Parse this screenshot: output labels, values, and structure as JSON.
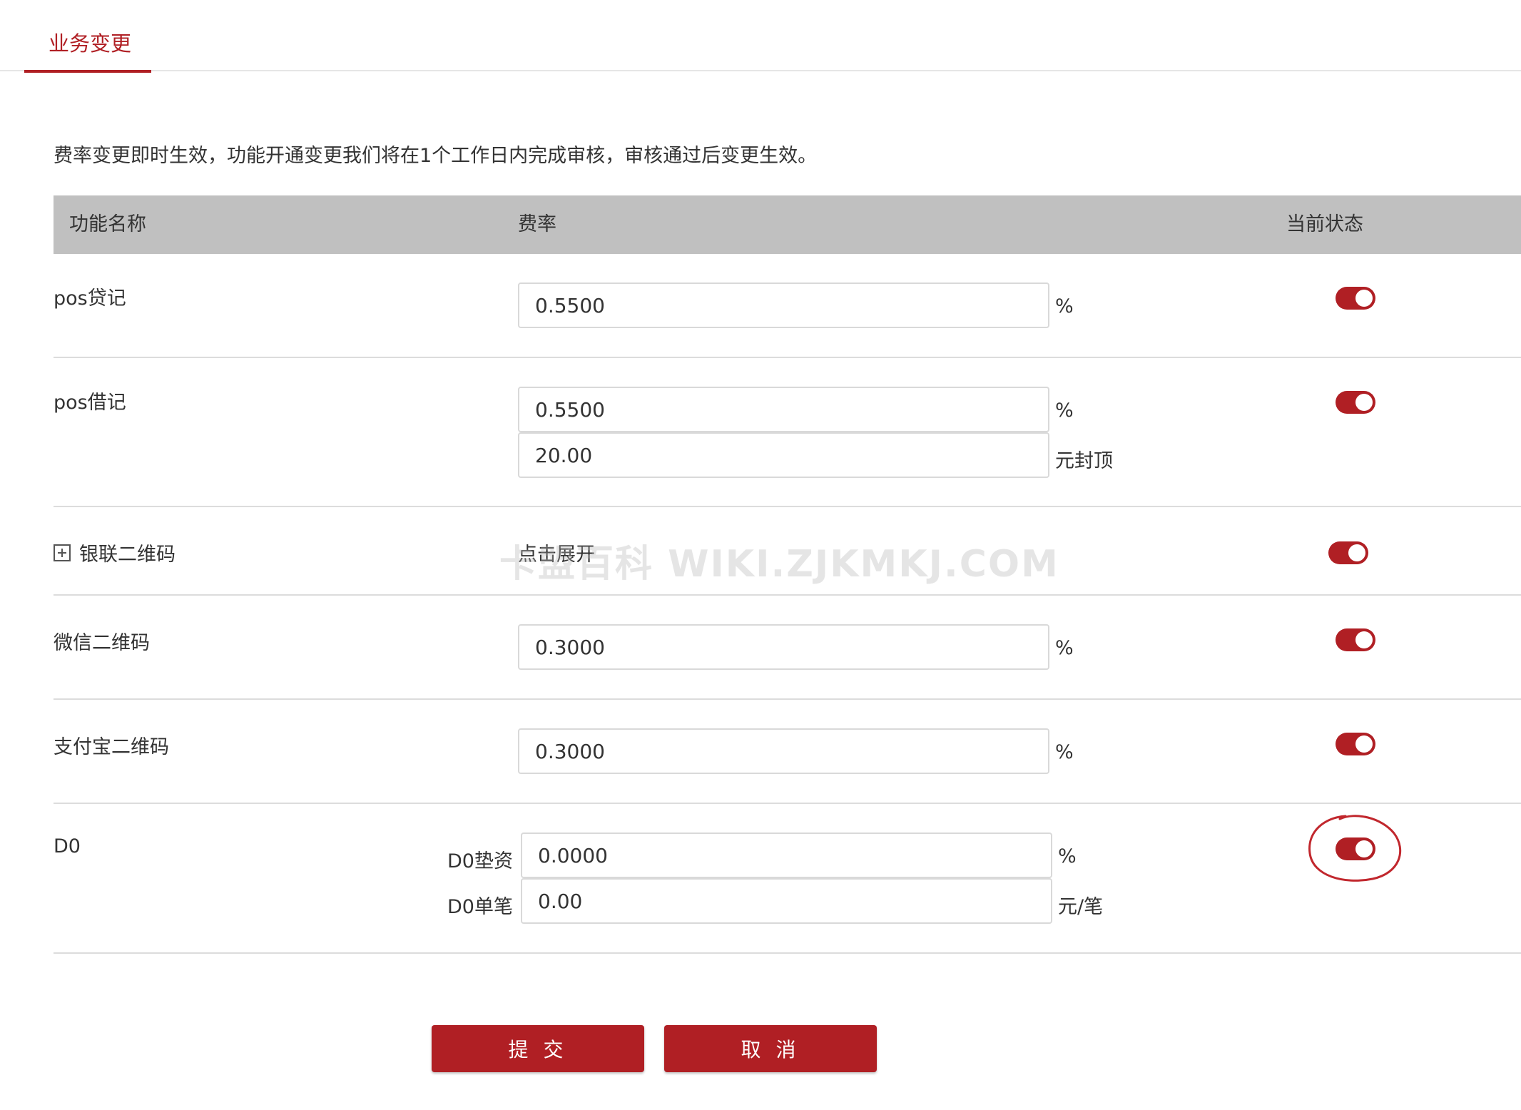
{
  "tabs": [
    {
      "label": "业务变更"
    }
  ],
  "notice": "费率变更即时生效，功能开通变更我们将在1个工作日内完成审核，审核通过后变更生效。",
  "table": {
    "headers": {
      "name": "功能名称",
      "rate": "费率",
      "status": "当前状态"
    }
  },
  "rows": {
    "pos_credit": {
      "name": "pos贷记",
      "rate_value": "0.5500",
      "rate_unit": "%",
      "enabled": true
    },
    "pos_debit": {
      "name": "pos借记",
      "rate_value": "0.5500",
      "rate_unit": "%",
      "cap_value": "20.00",
      "cap_unit": "元封顶",
      "enabled": true
    },
    "unionpay_qr": {
      "name": "银联二维码",
      "expand_label": "点击展开",
      "enabled": true
    },
    "wechat_qr": {
      "name": "微信二维码",
      "rate_value": "0.3000",
      "rate_unit": "%",
      "enabled": true
    },
    "alipay_qr": {
      "name": "支付宝二维码",
      "rate_value": "0.3000",
      "rate_unit": "%",
      "enabled": true
    },
    "d0": {
      "name": "D0",
      "advance_label": "D0垫资",
      "advance_value": "0.0000",
      "advance_unit": "%",
      "per_txn_label": "D0单笔",
      "per_txn_value": "0.00",
      "per_txn_unit": "元/笔",
      "enabled": true
    }
  },
  "watermark": "卡盟百科  WIKI.ZJKMKJ.COM",
  "buttons": {
    "submit": "提 交",
    "cancel": "取 消"
  },
  "colors": {
    "accent": "#b01f24",
    "header_bg": "#c0c0c0"
  }
}
